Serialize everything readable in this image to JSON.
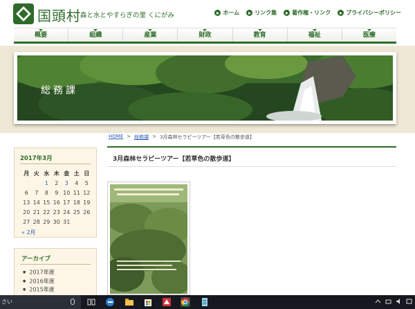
{
  "header": {
    "site_title": "国頭村",
    "tagline": "森と水とやすらぎの里 くにがみ",
    "links": [
      "ホーム",
      "リンク集",
      "著作権・リンク",
      "プライバシーポリシー"
    ]
  },
  "nav": [
    "概要",
    "組織",
    "産業",
    "財政",
    "教育",
    "福祉",
    "医療"
  ],
  "banner": {
    "title": "総務課"
  },
  "breadcrumb": {
    "home": "HOME",
    "section": "総務課",
    "current": "3月森林セラピーツアー【若草色の散歩道】"
  },
  "post": {
    "title": "3月森林セラピーツアー【若草色の散歩道】"
  },
  "calendar": {
    "title": "2017年3月",
    "weekdays": [
      "月",
      "火",
      "水",
      "木",
      "金",
      "土",
      "日"
    ],
    "weeks": [
      [
        "",
        "",
        "1",
        "2",
        "3",
        "4",
        "5"
      ],
      [
        "6",
        "7",
        "8",
        "9",
        "10",
        "11",
        "12"
      ],
      [
        "13",
        "14",
        "15",
        "16",
        "17",
        "18",
        "19"
      ],
      [
        "20",
        "21",
        "22",
        "23",
        "24",
        "25",
        "26"
      ],
      [
        "27",
        "28",
        "29",
        "30",
        "31",
        "",
        ""
      ]
    ],
    "linked_days": [
      "1",
      "3"
    ],
    "prev": "« 2月"
  },
  "archive": {
    "title": "アーカイブ",
    "items": [
      "2017年度",
      "2016年度",
      "2015年度"
    ]
  },
  "taskbar": {
    "search_text": "さい"
  },
  "colors": {
    "brand_green": "#2e6b2a",
    "band": "#efe7d5",
    "link": "#2a5db0"
  }
}
